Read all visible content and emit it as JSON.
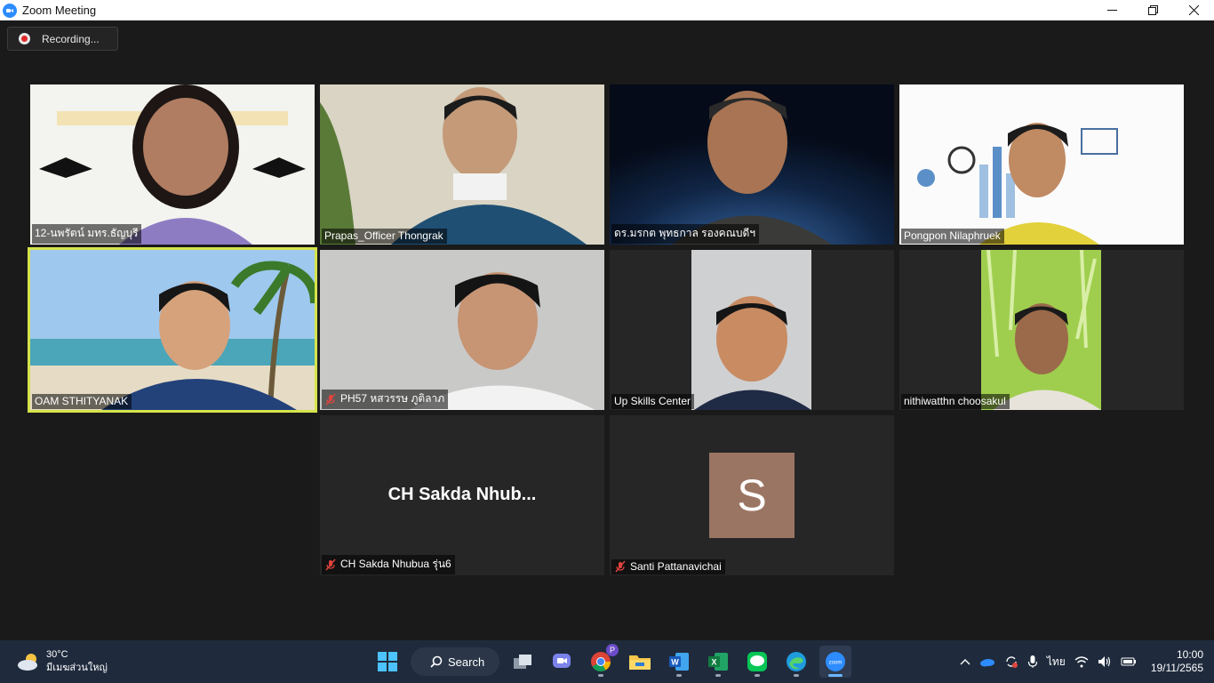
{
  "window": {
    "title": "Zoom Meeting"
  },
  "recording": {
    "label": "Recording..."
  },
  "participants": [
    {
      "name": "12-นพรัตน์ มทร.ธัญบุรี",
      "muted": false
    },
    {
      "name": "Prapas_Officer Thongrak",
      "muted": false
    },
    {
      "name": "ดร.มรกต พุทธกาล รองคณบดีฯ",
      "muted": false
    },
    {
      "name": "Pongpon Nilaphruek",
      "muted": false
    },
    {
      "name": "OAM STHITYANAK",
      "muted": false,
      "active_speaker": true
    },
    {
      "name": "PH57 หสวรรษ ภูติลาภ",
      "muted": true
    },
    {
      "name": "Up Skills Center",
      "muted": false
    },
    {
      "name": "nithiwatthn choosakul",
      "muted": false
    },
    {
      "name": "CH Sakda Nhubua รุ่น6",
      "muted": true,
      "display_text": "CH Sakda Nhub..."
    },
    {
      "name": "Santi Pattanavichai",
      "muted": true,
      "avatar_letter": "S"
    }
  ],
  "taskbar": {
    "weather": {
      "temp": "30°C",
      "desc": "มีเมฆส่วนใหญ่"
    },
    "search_label": "Search",
    "language": "ไทย",
    "time": "10:00",
    "date": "19/11/2565",
    "badge": "P"
  },
  "colors": {
    "accent": "#d6e34b",
    "zoom_blue": "#2d8cff",
    "taskbar": "#1f2b3d"
  }
}
